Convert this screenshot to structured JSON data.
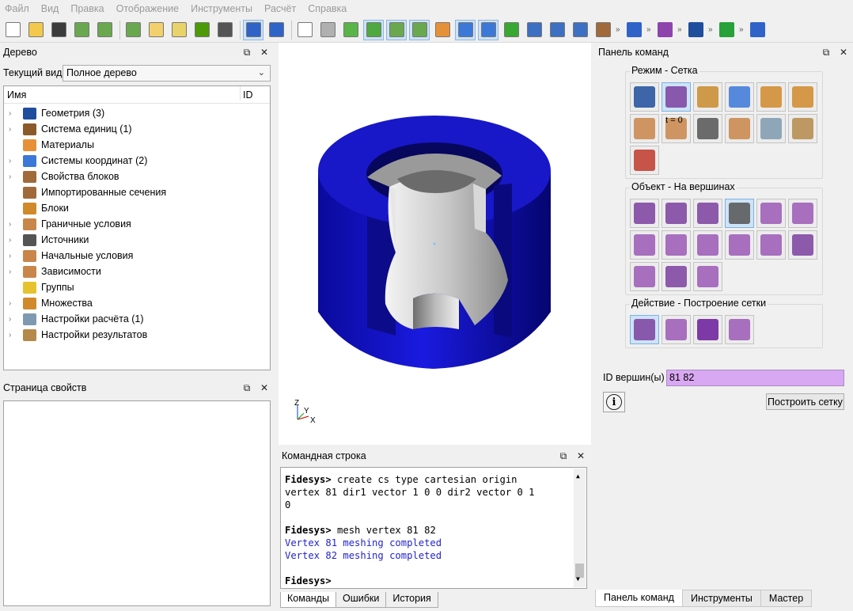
{
  "menu": [
    "Файл",
    "Вид",
    "Правка",
    "Отображение",
    "Инструменты",
    "Расчёт",
    "Справка"
  ],
  "toolbar": {
    "more_glyph": "»",
    "buttons": [
      {
        "icon": "new-file-icon",
        "color": "#ffffff",
        "active": false
      },
      {
        "icon": "open-folder-icon",
        "color": "#f2c94c",
        "active": false
      },
      {
        "icon": "save-icon",
        "color": "#3c3c3c",
        "active": false
      },
      {
        "icon": "import-icon",
        "color": "#6aa84f",
        "active": false
      },
      {
        "icon": "export-icon",
        "color": "#6aa84f",
        "active": false
      },
      {
        "sep": true
      },
      {
        "icon": "script-icon",
        "color": "#6aa84f",
        "active": false
      },
      {
        "icon": "edit-script-icon",
        "color": "#f2d06b",
        "active": false
      },
      {
        "icon": "run-script-icon",
        "color": "#e9d26a",
        "active": false
      },
      {
        "icon": "pause-icon",
        "color": "#4e9a06",
        "active": false
      },
      {
        "icon": "hammer-icon",
        "color": "#555555",
        "active": false
      },
      {
        "sep": true
      },
      {
        "icon": "select-mode-icon",
        "color": "#2f63c8",
        "active": true
      },
      {
        "icon": "undo-icon",
        "color": "#2f63c8",
        "active": false
      },
      {
        "sep": true
      },
      {
        "icon": "wireframe-cube-icon",
        "color": "#ffffff",
        "active": false
      },
      {
        "icon": "hidden-line-cube-icon",
        "color": "#b0b0b0",
        "active": false
      },
      {
        "icon": "shaded-cube-icon",
        "color": "#59b548",
        "active": false
      },
      {
        "icon": "solid-cube-icon",
        "color": "#4fa83f",
        "active": true
      },
      {
        "icon": "shapes-icon",
        "color": "#6aa84f",
        "active": true
      },
      {
        "icon": "mesh-cube-icon",
        "color": "#6aa84f",
        "active": true
      },
      {
        "icon": "truck-icon",
        "color": "#e69138",
        "active": false
      },
      {
        "icon": "axes-grid-icon",
        "color": "#3c78d8",
        "active": true
      },
      {
        "icon": "window-icon",
        "color": "#3c78d8",
        "active": true
      },
      {
        "icon": "rotate-icon",
        "color": "#38a832",
        "active": false
      },
      {
        "icon": "zoom-in-icon",
        "color": "#3d6fc2",
        "active": false
      },
      {
        "icon": "zoom-out-icon",
        "color": "#3d6fc2",
        "active": false
      },
      {
        "icon": "fit-view-icon",
        "color": "#3d6fc2",
        "active": false
      },
      {
        "icon": "box-view-icon",
        "color": "#a06a3a",
        "active": false
      }
    ],
    "trailing": [
      {
        "icon": "group-people-icon",
        "color": "#2f63c8"
      },
      {
        "icon": "crosshair-icon",
        "color": "#8e44ad"
      },
      {
        "icon": "node-frame-icon",
        "color": "#1f4e9c"
      },
      {
        "icon": "play-icon",
        "color": "#27a13a"
      },
      {
        "icon": "coord-axes-icon",
        "color": "#2f63c8"
      }
    ]
  },
  "tree_panel": {
    "title": "Дерево",
    "view_label": "Текущий вид",
    "view_value": "Полное дерево",
    "col_name": "Имя",
    "col_id": "ID",
    "items": [
      {
        "label": "Геометрия (3)",
        "icon": "geometry-icon",
        "color": "#1f4e9c",
        "expandable": true
      },
      {
        "label": "Система единиц (1)",
        "icon": "units-icon",
        "color": "#8a5a2b",
        "expandable": true
      },
      {
        "label": "Материалы",
        "icon": "materials-icon",
        "color": "#e69138",
        "expandable": false
      },
      {
        "label": "Системы координат (2)",
        "icon": "coordinate-systems-icon",
        "color": "#3c78d8",
        "expandable": true
      },
      {
        "label": "Свойства блоков",
        "icon": "block-properties-icon",
        "color": "#a06a3a",
        "expandable": true
      },
      {
        "label": "Импортированные сечения",
        "icon": "imported-sections-icon",
        "color": "#a06a3a",
        "expandable": false
      },
      {
        "label": "Блоки",
        "icon": "blocks-icon",
        "color": "#d08a2b",
        "expandable": false
      },
      {
        "label": "Граничные условия",
        "icon": "boundary-conditions-icon",
        "color": "#c9864a",
        "expandable": true
      },
      {
        "label": "Источники",
        "icon": "sources-icon",
        "color": "#555555",
        "expandable": true
      },
      {
        "label": "Начальные условия",
        "icon": "initial-conditions-icon",
        "color": "#c9864a",
        "expandable": true
      },
      {
        "label": "Зависимости",
        "icon": "dependencies-icon",
        "color": "#c9864a",
        "expandable": true
      },
      {
        "label": "Группы",
        "icon": "groups-icon",
        "color": "#e6c32e",
        "expandable": false
      },
      {
        "label": "Множества",
        "icon": "sets-icon",
        "color": "#d08a2b",
        "expandable": true
      },
      {
        "label": "Настройки расчёта (1)",
        "icon": "analysis-settings-icon",
        "color": "#7f9ab0",
        "expandable": true
      },
      {
        "label": "Настройки результатов",
        "icon": "results-settings-icon",
        "color": "#b5894a",
        "expandable": true
      }
    ]
  },
  "props_panel": {
    "title": "Страница свойств"
  },
  "viewport": {
    "axis_labels": {
      "z": "Z",
      "y": "Y",
      "x": "X"
    }
  },
  "command_line": {
    "title": "Командная строка",
    "lines": [
      {
        "prompt": "Fidesys> ",
        "text": "create cs type cartesian origin",
        "style": "normal"
      },
      {
        "prompt": "",
        "text": "vertex 81 dir1 vector 1 0 0 dir2 vector 0 1",
        "style": "normal"
      },
      {
        "prompt": "",
        "text": "0",
        "style": "normal"
      },
      {
        "prompt": "",
        "text": "",
        "style": "normal"
      },
      {
        "prompt": "Fidesys> ",
        "text": "mesh vertex 81 82",
        "style": "normal"
      },
      {
        "prompt": "",
        "text": "Vertex 81 meshing completed",
        "style": "blue"
      },
      {
        "prompt": "",
        "text": "Vertex 82 meshing completed",
        "style": "blue"
      },
      {
        "prompt": "",
        "text": "",
        "style": "normal"
      },
      {
        "prompt": "Fidesys> ",
        "text": "",
        "style": "normal"
      }
    ],
    "tabs": [
      "Команды",
      "Ошибки",
      "История"
    ]
  },
  "command_panel": {
    "title": "Панель команд",
    "mode_label": "Режим - Сетка",
    "object_label": "Объект - На вершинах",
    "action_label": "Действие - Построение сетки",
    "t0_label": "t = 0",
    "mode_buttons": [
      {
        "icon": "geometry-mode-icon",
        "color": "#1f4e9c",
        "active": false
      },
      {
        "icon": "mesh-mode-icon",
        "color": "#7b3fa0",
        "active": true
      },
      {
        "icon": "material-mode-icon",
        "color": "#c98b2b",
        "active": false
      },
      {
        "icon": "coordinate-mode-icon",
        "color": "#3c78d8",
        "active": false
      },
      {
        "icon": "blocks-mode-icon",
        "color": "#d08a2b",
        "active": false
      },
      {
        "icon": "sets-mode-icon",
        "color": "#d08a2b",
        "active": false
      },
      {
        "icon": "boundary-mode-icon",
        "color": "#c9864a",
        "active": false
      },
      {
        "icon": "initial-conditions-mode-icon",
        "color": "#c9864a",
        "active": false
      },
      {
        "icon": "sources-mode-icon",
        "color": "#555555",
        "active": false
      },
      {
        "icon": "dependencies-mode-icon",
        "color": "#c9864a",
        "active": false
      },
      {
        "icon": "analysis-mode-icon",
        "color": "#7f9ab0",
        "active": false
      },
      {
        "icon": "results-mode-icon",
        "color": "#b5894a",
        "active": false
      },
      {
        "icon": "inspect-mode-icon",
        "color": "#c0392b",
        "active": false
      }
    ],
    "object_buttons": [
      {
        "icon": "volume-object-icon",
        "color": "#7b3fa0",
        "active": false
      },
      {
        "icon": "surface-object-icon",
        "color": "#7b3fa0",
        "active": false
      },
      {
        "icon": "curve-object-icon",
        "color": "#7b3fa0",
        "active": false
      },
      {
        "icon": "vertex-object-icon",
        "color": "#555555",
        "active": true
      },
      {
        "icon": "group-object-icon",
        "color": "#9b59b6",
        "active": false
      },
      {
        "icon": "node-object-icon",
        "color": "#9b59b6",
        "active": false
      },
      {
        "icon": "tet-object-icon",
        "color": "#9b59b6",
        "active": false
      },
      {
        "icon": "quad-object-icon",
        "color": "#9b59b6",
        "active": false
      },
      {
        "icon": "tri-object-icon",
        "color": "#9b59b6",
        "active": false
      },
      {
        "icon": "edge-object-icon",
        "color": "#9b59b6",
        "active": false
      },
      {
        "icon": "point-object-icon",
        "color": "#9b59b6",
        "active": false
      },
      {
        "icon": "extrude-object-icon",
        "color": "#7b3fa0",
        "active": false
      },
      {
        "icon": "quality-object-icon",
        "color": "#9b59b6",
        "active": false
      },
      {
        "icon": "grid-object-icon",
        "color": "#7b3fa0",
        "active": false
      },
      {
        "icon": "element-block-object-icon",
        "color": "#9b59b6",
        "active": false
      }
    ],
    "action_buttons": [
      {
        "icon": "mesh-build-icon",
        "color": "#7b3fa0",
        "active": true
      },
      {
        "icon": "mesh-quality-icon",
        "color": "#9b59b6",
        "active": false
      },
      {
        "icon": "mesh-delete-icon",
        "color": "#6a1b9a",
        "active": false
      },
      {
        "icon": "mesh-refine-icon",
        "color": "#9b59b6",
        "active": false
      }
    ],
    "vertex_id_label": "ID вершин(ы)",
    "vertex_id_value": "81 82",
    "info_glyph": "i",
    "mesh_button": "Построить сетку",
    "tabs": [
      "Панель команд",
      "Инструменты",
      "Мастер"
    ]
  },
  "panel_controls": {
    "float": "⧉",
    "close": "✕"
  }
}
